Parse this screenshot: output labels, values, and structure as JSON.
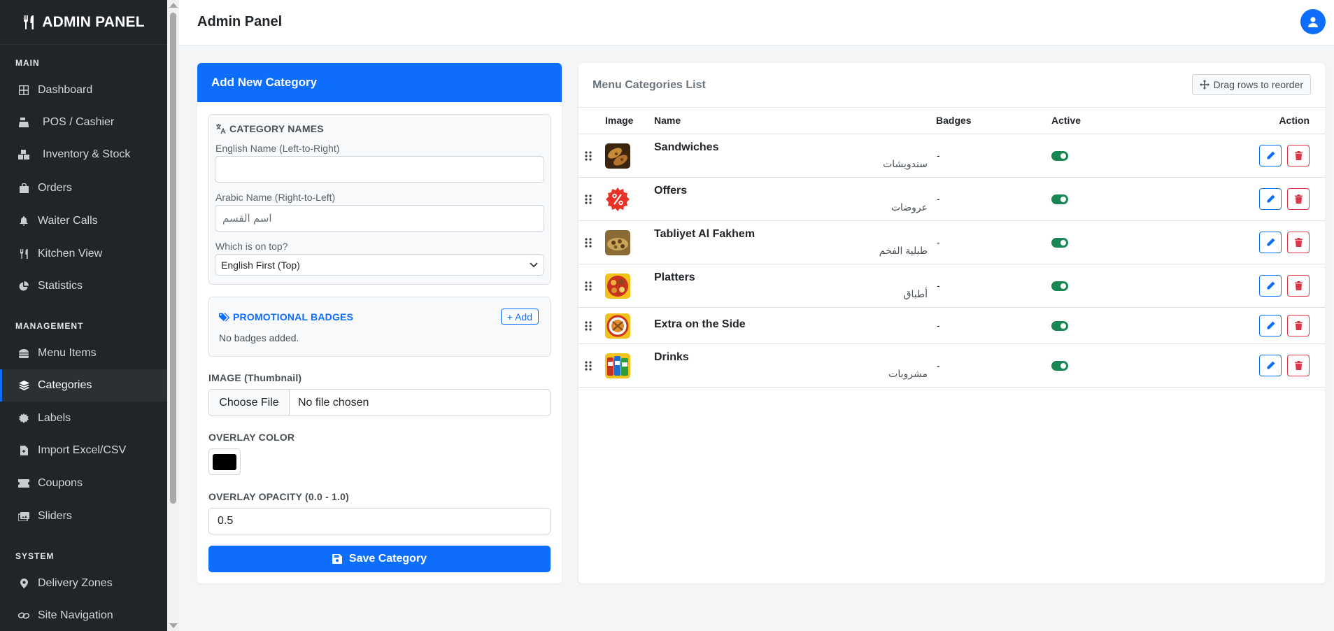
{
  "brand": {
    "title": "ADMIN PANEL"
  },
  "sidebar": {
    "sections": [
      {
        "title": "MAIN"
      },
      {
        "title": "MANAGEMENT"
      },
      {
        "title": "SYSTEM"
      }
    ],
    "items": [
      {
        "label": "Dashboard",
        "icon": "grid-icon"
      },
      {
        "label": "POS / Cashier",
        "icon": "cash-register-icon"
      },
      {
        "label": "Inventory & Stock",
        "icon": "boxes-icon"
      },
      {
        "label": "Orders",
        "icon": "shopping-bag-icon"
      },
      {
        "label": "Waiter Calls",
        "icon": "bell-icon"
      },
      {
        "label": "Kitchen View",
        "icon": "utensils-icon"
      },
      {
        "label": "Statistics",
        "icon": "pie-chart-icon"
      },
      {
        "label": "Menu Items",
        "icon": "burger-icon"
      },
      {
        "label": "Categories",
        "icon": "layers-icon",
        "active": true
      },
      {
        "label": "Labels",
        "icon": "certificate-icon"
      },
      {
        "label": "Import Excel/CSV",
        "icon": "file-import-icon"
      },
      {
        "label": "Coupons",
        "icon": "ticket-icon"
      },
      {
        "label": "Sliders",
        "icon": "images-icon"
      },
      {
        "label": "Delivery Zones",
        "icon": "map-pin-icon"
      },
      {
        "label": "Site Navigation",
        "icon": "link-icon"
      }
    ]
  },
  "header": {
    "title": "Admin Panel"
  },
  "form": {
    "card_title": "Add New Category",
    "names_section_title": "CATEGORY NAMES",
    "english_label": "English Name (Left-to-Right)",
    "english_value": "",
    "arabic_label": "Arabic Name (Right-to-Left)",
    "arabic_placeholder": "اسم القسم",
    "order_label": "Which is on top?",
    "order_value": "English First (Top)",
    "badges_title": "PROMOTIONAL BADGES",
    "add_badge_label": "+ Add",
    "no_badges_text": "No badges added.",
    "image_label": "IMAGE (Thumbnail)",
    "choose_file_label": "Choose File",
    "no_file_text": "No file chosen",
    "overlay_color_label": "OVERLAY COLOR",
    "overlay_color": "#000000",
    "overlay_opacity_label": "OVERLAY OPACITY (0.0 - 1.0)",
    "overlay_opacity_value": "0.5",
    "save_label": "Save Category"
  },
  "list": {
    "title": "Menu Categories List",
    "drag_hint": "Drag rows to reorder",
    "columns": [
      "Image",
      "Name",
      "Badges",
      "Active",
      "Action"
    ],
    "rows": [
      {
        "name_en": "Sandwiches",
        "name_ar": "سندويشات",
        "badges": "-",
        "active": true
      },
      {
        "name_en": "Offers",
        "name_ar": "عروضات",
        "badges": "-",
        "active": true
      },
      {
        "name_en": "Tabliyet Al Fakhem",
        "name_ar": "طبلية الفخم",
        "badges": "-",
        "active": true
      },
      {
        "name_en": "Platters",
        "name_ar": "أطباق",
        "badges": "-",
        "active": true
      },
      {
        "name_en": "Extra on the Side",
        "name_ar": "",
        "badges": "-",
        "active": true
      },
      {
        "name_en": "Drinks",
        "name_ar": "مشروبات",
        "badges": "-",
        "active": true
      }
    ]
  },
  "colors": {
    "primary": "#0d6efd",
    "sidebar_bg": "#212529",
    "danger": "#dc3545",
    "success": "#198754"
  }
}
